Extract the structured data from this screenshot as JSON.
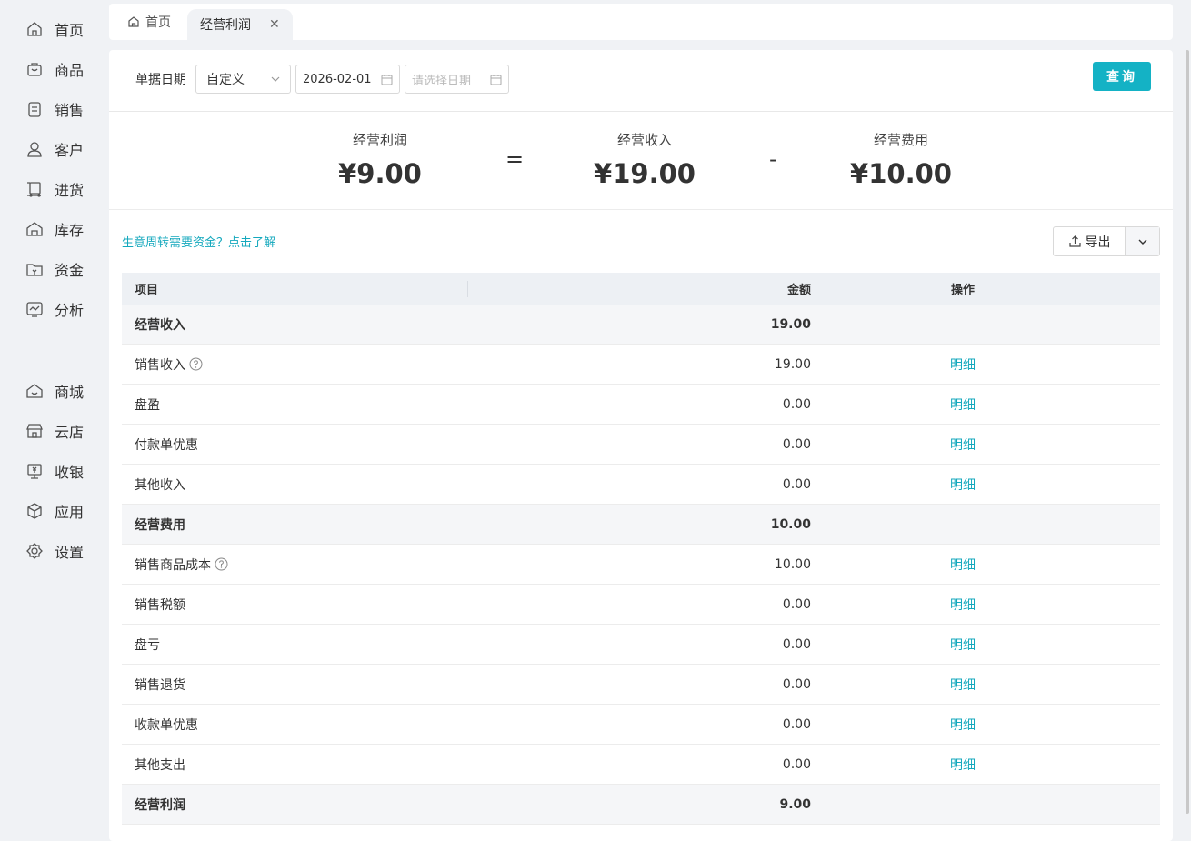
{
  "sidebar": {
    "items": [
      {
        "label": "首页",
        "icon": "home-icon"
      },
      {
        "label": "商品",
        "icon": "bag-icon"
      },
      {
        "label": "销售",
        "icon": "clipboard-icon"
      },
      {
        "label": "客户",
        "icon": "user-icon"
      },
      {
        "label": "进货",
        "icon": "cart-icon"
      },
      {
        "label": "库存",
        "icon": "warehouse-icon"
      },
      {
        "label": "资金",
        "icon": "wallet-icon"
      },
      {
        "label": "分析",
        "icon": "chart-icon"
      },
      {
        "label": "商城",
        "icon": "mall-icon"
      },
      {
        "label": "云店",
        "icon": "store-icon"
      },
      {
        "label": "收银",
        "icon": "cashier-icon"
      },
      {
        "label": "应用",
        "icon": "app-icon"
      },
      {
        "label": "设置",
        "icon": "gear-icon"
      }
    ]
  },
  "tabs": [
    {
      "label": "首页",
      "active": false
    },
    {
      "label": "经营利润",
      "active": true
    }
  ],
  "filter": {
    "label": "单据日期",
    "range_type": "自定义",
    "start_date": "2026-02-01",
    "end_date_placeholder": "请选择日期",
    "query_label": "查询"
  },
  "summary": {
    "profit": {
      "label": "经营利润",
      "value": "¥9.00"
    },
    "equals": "=",
    "income": {
      "label": "经营收入",
      "value": "¥19.00"
    },
    "minus": "-",
    "expense": {
      "label": "经营费用",
      "value": "¥10.00"
    }
  },
  "promo_link": "生意周转需要资金？点击了解",
  "export_label": "导出",
  "table": {
    "headers": {
      "item": "项目",
      "amount": "金额",
      "action": "操作"
    },
    "detail_label": "明细",
    "rows": [
      {
        "item": "经营收入",
        "amount": "19.00",
        "group": true
      },
      {
        "item": "销售收入",
        "amount": "19.00",
        "help": true
      },
      {
        "item": "盘盈",
        "amount": "0.00"
      },
      {
        "item": "付款单优惠",
        "amount": "0.00"
      },
      {
        "item": "其他收入",
        "amount": "0.00"
      },
      {
        "item": "经营费用",
        "amount": "10.00",
        "group": true
      },
      {
        "item": "销售商品成本",
        "amount": "10.00",
        "help": true
      },
      {
        "item": "销售税额",
        "amount": "0.00"
      },
      {
        "item": "盘亏",
        "amount": "0.00"
      },
      {
        "item": "销售退货",
        "amount": "0.00"
      },
      {
        "item": "收款单优惠",
        "amount": "0.00"
      },
      {
        "item": "其他支出",
        "amount": "0.00"
      },
      {
        "item": "经营利润",
        "amount": "9.00",
        "group": true
      }
    ]
  },
  "colors": {
    "accent": "#14b2c5",
    "link": "#14a8bd"
  }
}
